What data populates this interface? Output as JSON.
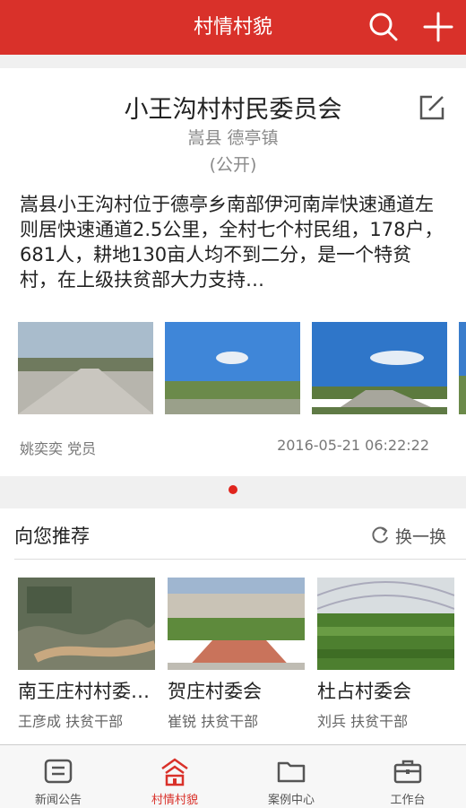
{
  "header": {
    "title": "村情村貌",
    "search_icon": "search-icon",
    "add_icon": "plus-icon"
  },
  "village": {
    "name": "小王沟村村民委员会",
    "region": "嵩县 德亭镇",
    "visibility": "(公开)",
    "description": "嵩县小王沟村位于德亭乡南部伊河南岸快速通道左则居快速通道2.5公里，全村七个村民组，178户，681人，耕地130亩人均不到二分，是一个特贫村，在上级扶贫部大力支持…",
    "author": "姚奕奕 党员",
    "time": "2016-05-21 06:22:22"
  },
  "recommend": {
    "title": "向您推荐",
    "refresh_label": "换一换",
    "items": [
      {
        "name": "南王庄村村委…",
        "person": "王彦成 扶贫干部"
      },
      {
        "name": "贺庄村委会",
        "person": "崔锐 扶贫干部"
      },
      {
        "name": "杜占村委会",
        "person": "刘兵 扶贫干部"
      }
    ]
  },
  "tabs": [
    {
      "label": "新闻公告",
      "icon": "news-icon"
    },
    {
      "label": "村情村貌",
      "icon": "village-icon"
    },
    {
      "label": "案例中心",
      "icon": "folder-icon"
    },
    {
      "label": "工作台",
      "icon": "briefcase-icon"
    }
  ],
  "colors": {
    "brand": "#d9312a",
    "active_tab": "#d9312a"
  }
}
